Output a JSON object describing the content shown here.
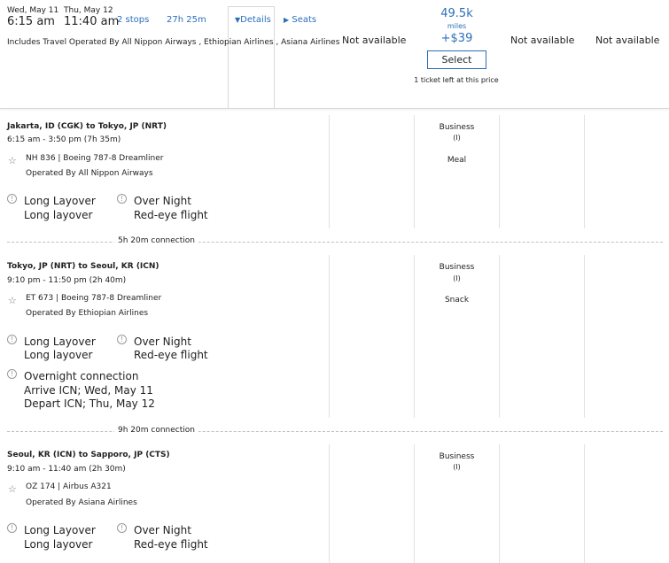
{
  "summary": {
    "depart_date": "Wed, May 11",
    "depart_time": "6:15 am",
    "arrive_date": "Thu, May 12",
    "arrive_time": "11:40 am",
    "stops": "2 stops",
    "duration": "27h 25m",
    "details_label": "Details",
    "seats_label": "Seats",
    "operated_by_note": "Includes Travel Operated By All Nippon Airways , Ethiopian Airlines , Asiana Airlines",
    "fares": {
      "col1": "Not available",
      "miles": "49.5k",
      "miles_unit": "miles",
      "tax": "+$39",
      "select_label": "Select",
      "tickets_left": "1 ticket left at this price",
      "col3": "Not available",
      "col4": "Not available"
    }
  },
  "segments": [
    {
      "route": "Jakarta, ID (CGK) to Tokyo, JP (NRT)",
      "times": "6:15 am - 3:50 pm (7h 35m)",
      "flight": "NH 836 | Boeing 787-8 Dreamliner",
      "operated_by": "Operated By All Nippon Airways",
      "cabin": "Business",
      "fare_code": "(I)",
      "meal": "Meal",
      "notes": [
        {
          "title": "Long Layover",
          "desc": "Long layover"
        },
        {
          "title": "Over Night",
          "desc": "Red-eye flight"
        }
      ]
    },
    {
      "route": "Tokyo, JP (NRT) to Seoul, KR (ICN)",
      "times": "9:10 pm - 11:50 pm (2h 40m)",
      "flight": "ET 673 | Boeing 787-8 Dreamliner",
      "operated_by": "Operated By Ethiopian Airlines",
      "cabin": "Business",
      "fare_code": "(I)",
      "meal": "Snack",
      "notes": [
        {
          "title": "Long Layover",
          "desc": "Long layover"
        },
        {
          "title": "Over Night",
          "desc": "Red-eye flight"
        }
      ],
      "overnight": {
        "title": "Overnight connection",
        "arrive": "Arrive ICN; Wed, May 11",
        "depart": "Depart ICN; Thu, May 12"
      }
    },
    {
      "route": "Seoul, KR (ICN) to Sapporo, JP (CTS)",
      "times": "9:10 am - 11:40 am (2h 30m)",
      "flight": "OZ 174 | Airbus A321",
      "operated_by": "Operated By Asiana Airlines",
      "cabin": "Business",
      "fare_code": "(I)",
      "meal": "",
      "notes": [
        {
          "title": "Long Layover",
          "desc": "Long layover"
        },
        {
          "title": "Over Night",
          "desc": "Red-eye flight"
        }
      ]
    }
  ],
  "connections": [
    "5h 20m connection",
    "9h 20m connection"
  ],
  "colors": {
    "accent": "#2a6ebb",
    "divider": "#e2e2e2"
  },
  "icons": {
    "details_caret": "triangle-down",
    "seats_caret": "triangle-right",
    "info": "exclamation-circle",
    "star": "star-outline"
  }
}
